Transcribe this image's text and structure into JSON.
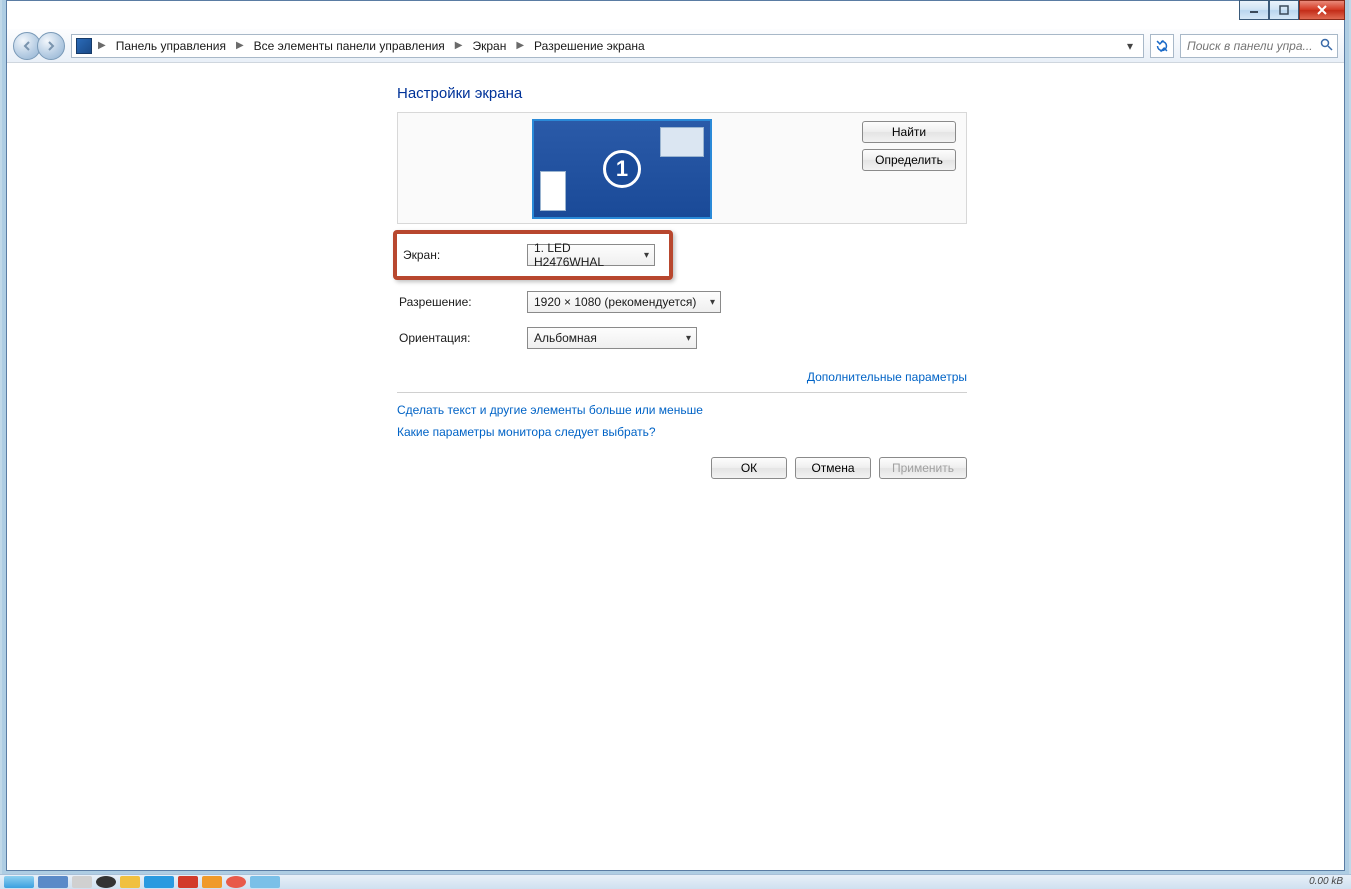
{
  "breadcrumb": {
    "items": [
      "Панель управления",
      "Все элементы панели управления",
      "Экран",
      "Разрешение экрана"
    ]
  },
  "search": {
    "placeholder": "Поиск в панели упра..."
  },
  "page": {
    "title": "Настройки экрана",
    "monitor_number": "1",
    "find_button": "Найти",
    "identify_button": "Определить",
    "labels": {
      "screen": "Экран:",
      "resolution": "Разрешение:",
      "orientation": "Ориентация:"
    },
    "values": {
      "screen": "1. LED H2476WHAL",
      "resolution": "1920 × 1080 (рекомендуется)",
      "orientation": "Альбомная"
    },
    "advanced_link": "Дополнительные параметры",
    "link1": "Сделать текст и другие элементы больше или меньше",
    "link2": "Какие параметры монитора следует выбрать?",
    "ok": "ОК",
    "cancel": "Отмена",
    "apply": "Применить"
  },
  "status": "0.00 kB"
}
